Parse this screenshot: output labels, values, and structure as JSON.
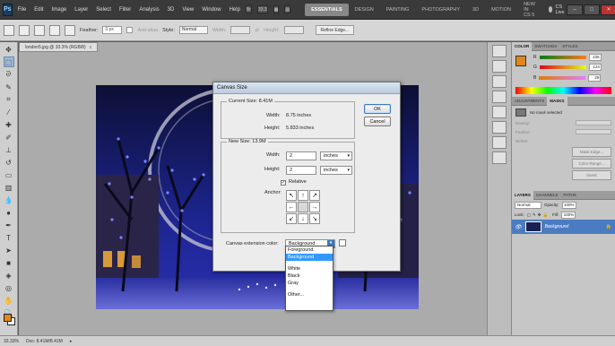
{
  "app": {
    "logo": "Ps"
  },
  "menu": [
    "File",
    "Edit",
    "Image",
    "Layer",
    "Select",
    "Filter",
    "Analysis",
    "3D",
    "View",
    "Window",
    "Help"
  ],
  "zoom_chip": "33.3",
  "workspaces": [
    "ESSENTIALS",
    "DESIGN",
    "PAINTING",
    "PHOTOGRAPHY",
    "3D",
    "MOTION",
    "NEW IN CS 5"
  ],
  "cslive": "CS Live",
  "options": {
    "feather_label": "Feather:",
    "feather_value": "0 px",
    "antialias_label": "Anti-alias",
    "style_label": "Style:",
    "style_value": "Normal",
    "width_label": "Width:",
    "height_label": "Height:",
    "refine_edge": "Refine Edge..."
  },
  "document": {
    "tab_title": "london5.jpg @ 33.3% (RGB/8)",
    "tab_close": "x"
  },
  "status": {
    "zoom": "33.33%",
    "doc": "Doc: 8.41M/8.41M"
  },
  "colors": {
    "foreground": "#e2851d",
    "background": "#ffffff",
    "accent": "#3399ff"
  },
  "panels": {
    "color_tabs": [
      "COLOR",
      "SWATCHES",
      "STYLES"
    ],
    "rgb": [
      {
        "channel": "R",
        "value": "226"
      },
      {
        "channel": "G",
        "value": "124"
      },
      {
        "channel": "B",
        "value": "29"
      }
    ],
    "adj_tabs": [
      "ADJUSTMENTS",
      "MASKS"
    ],
    "mask_status": "No mask selected",
    "mask_rows": [
      "Density:",
      "Feather:",
      "Refine:"
    ],
    "mask_buttons": [
      "Mask Edge...",
      "Color Range...",
      "Invert"
    ],
    "layer_tabs": [
      "LAYERS",
      "CHANNELS",
      "PATHS"
    ],
    "blend_mode": "Normal",
    "opacity_label": "Opacity:",
    "opacity_value": "100%",
    "lock_label": "Lock:",
    "fill_label": "Fill:",
    "fill_value": "100%",
    "layer_name": "Background"
  },
  "dialog": {
    "title": "Canvas Size",
    "current_size_label": "Current Size: 8.41M",
    "current_width_label": "Width:",
    "current_width_value": "8.75 inches",
    "current_height_label": "Height:",
    "current_height_value": "5.833 inches",
    "new_size_label": "New Size: 13.9M",
    "width_label": "Width:",
    "width_value": "2",
    "width_unit": "inches",
    "height_label": "Height:",
    "height_value": "2",
    "height_unit": "inches",
    "relative_label": "Relative",
    "relative_checked": "✓",
    "anchor_label": "Anchor:",
    "anchor_arrows": [
      "↖",
      "↑",
      "↗",
      "←",
      "",
      "→",
      "↙",
      "↓",
      "↘"
    ],
    "ok_label": "OK",
    "cancel_label": "Cancel",
    "extension_label": "Canvas extension color:",
    "extension_value": "Background"
  },
  "dropdown": {
    "options": [
      "Foreground",
      "Background",
      "White",
      "Black",
      "Gray",
      "Other..."
    ],
    "highlighted": "Background"
  }
}
